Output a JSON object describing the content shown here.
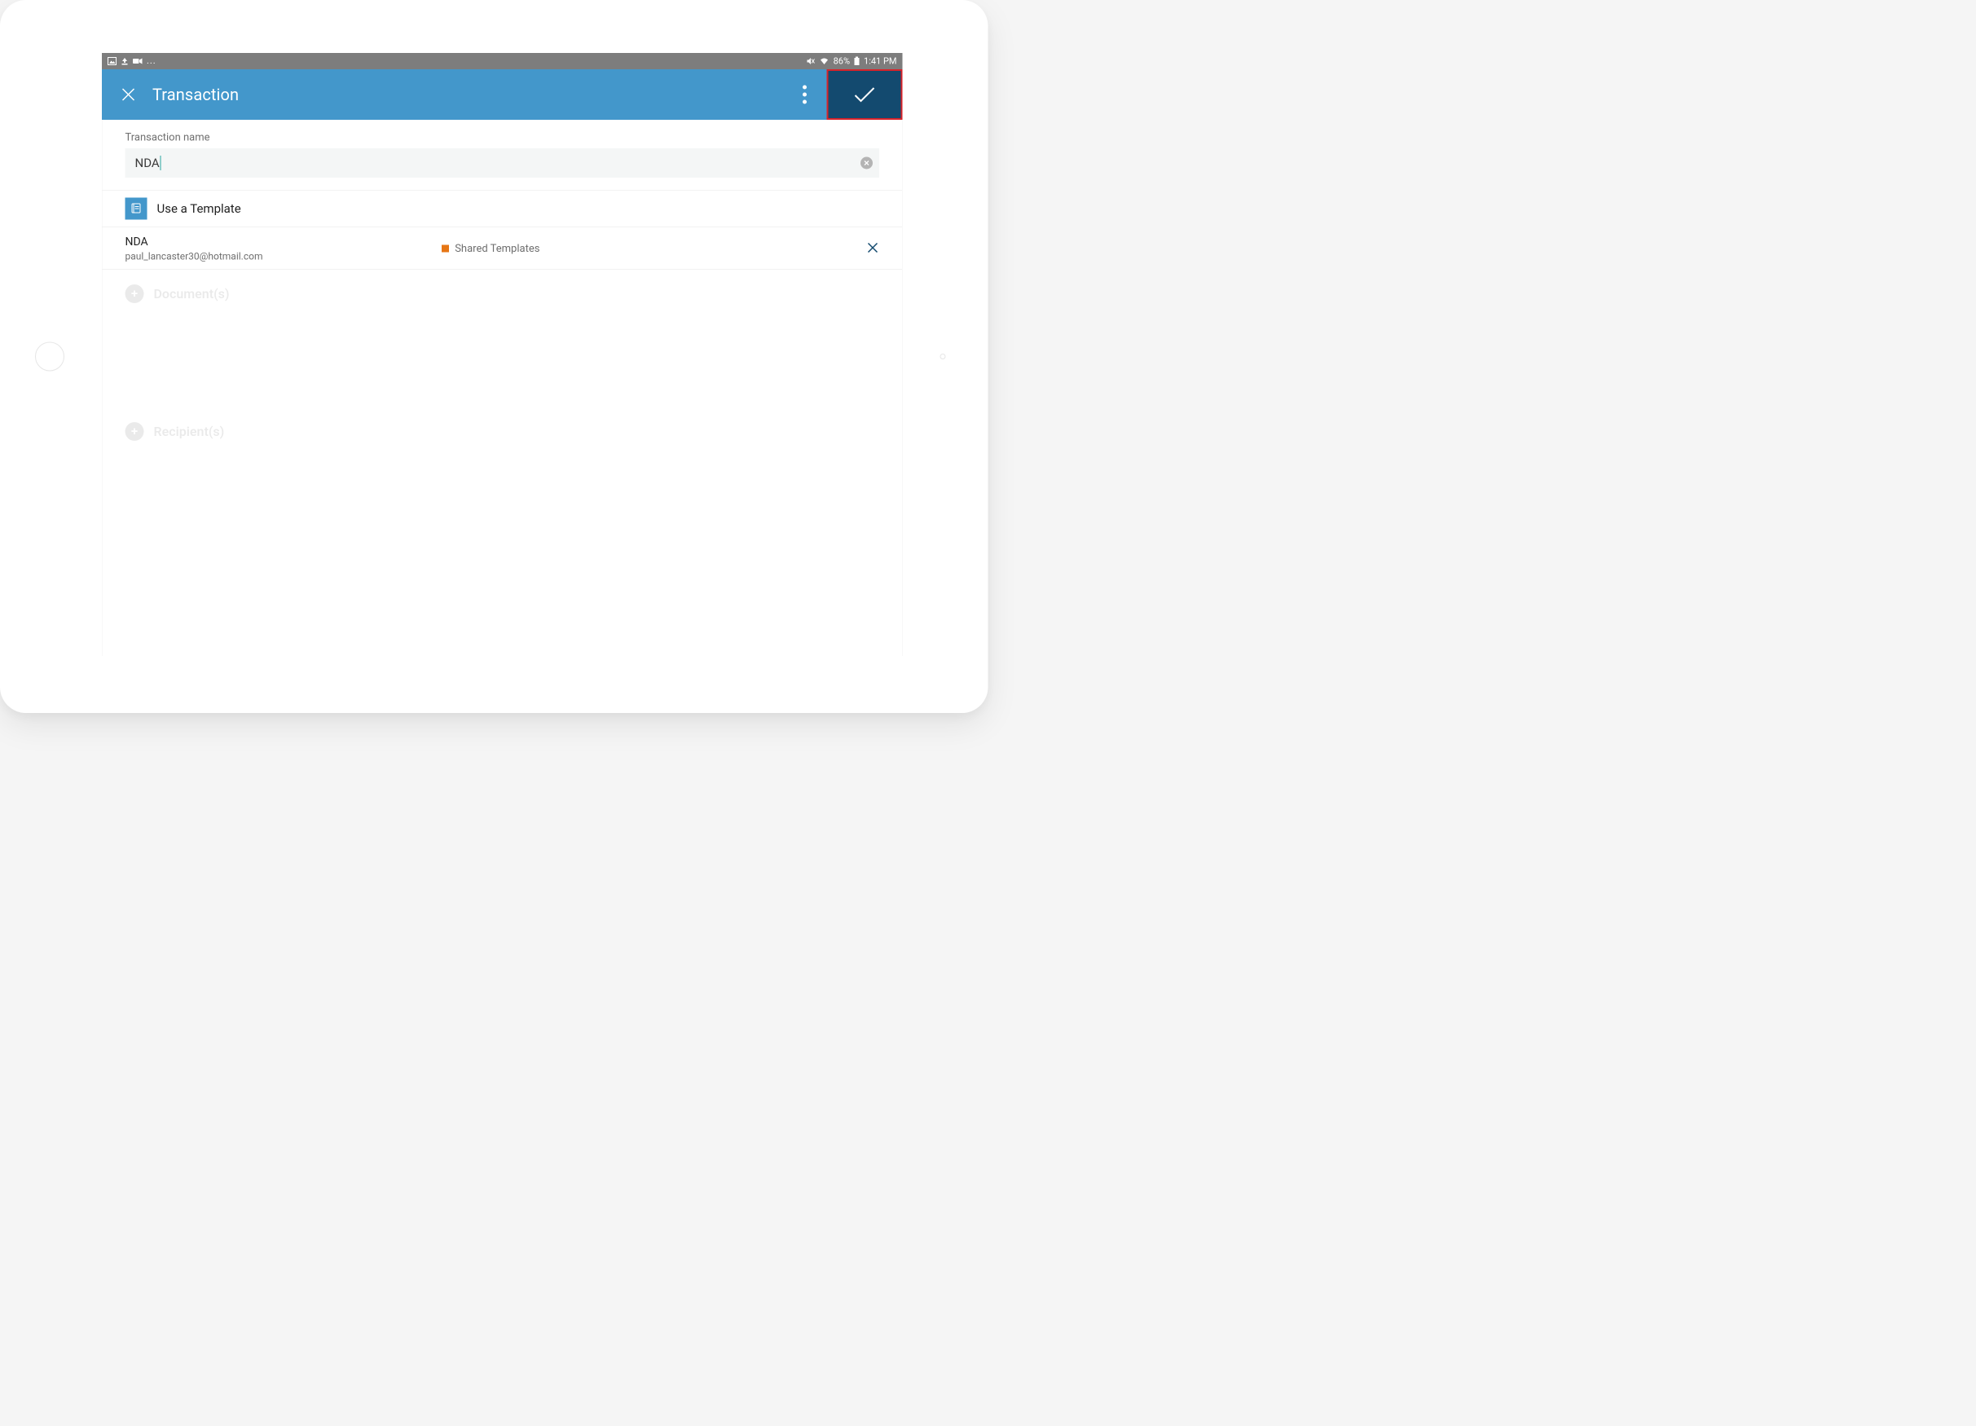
{
  "status_bar": {
    "battery_percent": "86%",
    "time": "1:41 PM"
  },
  "header": {
    "title": "Transaction",
    "confirm_highlighted": true
  },
  "form": {
    "transaction_name_label": "Transaction name",
    "transaction_name_value": "NDA"
  },
  "template_section": {
    "title": "Use a Template",
    "selected": {
      "name": "NDA",
      "email": "paul_lancaster30@hotmail.com",
      "tag_label": "Shared Templates",
      "tag_color": "#e67615"
    }
  },
  "ghost_sections": {
    "documents_label": "Document(s)",
    "recipients_label": "Recipient(s)"
  }
}
